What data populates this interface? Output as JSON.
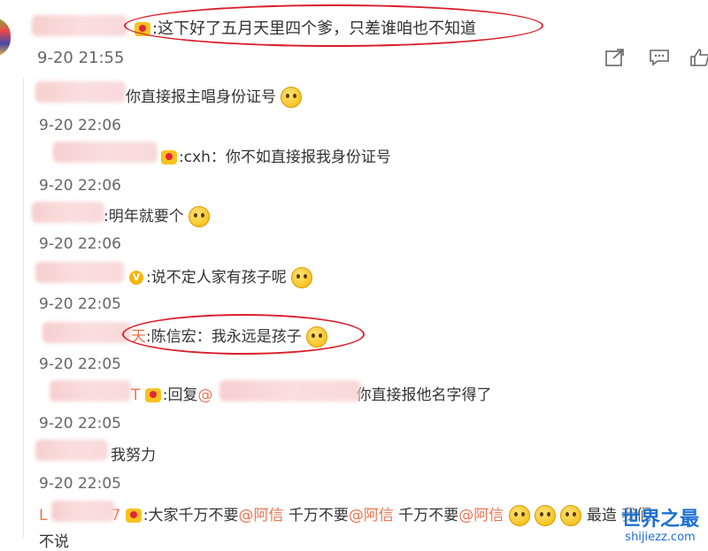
{
  "main_comment": {
    "text": ":这下好了五月天里四个爹，只差谁咱也不知道",
    "timestamp": "9-20 21:55"
  },
  "actions": {
    "share_icon": "share-icon",
    "comment_icon": "comment-icon",
    "like_icon": "like-icon"
  },
  "replies": [
    {
      "text": "你直接报主唱身份证号",
      "timestamp": "9-20 22:06"
    },
    {
      "text": ":cxh：你不如直接报我身份证号",
      "timestamp": "9-20 22:06"
    },
    {
      "text": ":明年就要个",
      "timestamp": "9-20 22:06"
    },
    {
      "text": ":说不定人家有孩子呢",
      "timestamp": "9-20 22:05"
    },
    {
      "name_tail": "天",
      "text": ":陈信宏：我永远是孩子",
      "timestamp": "9-20 22:05"
    },
    {
      "name_tail": "T",
      "prefix": ":回复",
      "mention": "@",
      "text": "你直接报他名字得了",
      "timestamp": "9-20 22:05"
    },
    {
      "text": "我努力",
      "timestamp": "9-20 22:05"
    },
    {
      "name_head": "L",
      "name_tail": "7",
      "segments": [
        ":大家千万不要",
        "@阿信",
        " 千万不要",
        "@阿信",
        " 千万不要",
        "@阿信"
      ],
      "tail": "最造 我们",
      "overflow": "不说"
    }
  ],
  "watermark": {
    "title": "世界之最",
    "url": "shijiezz.com"
  }
}
